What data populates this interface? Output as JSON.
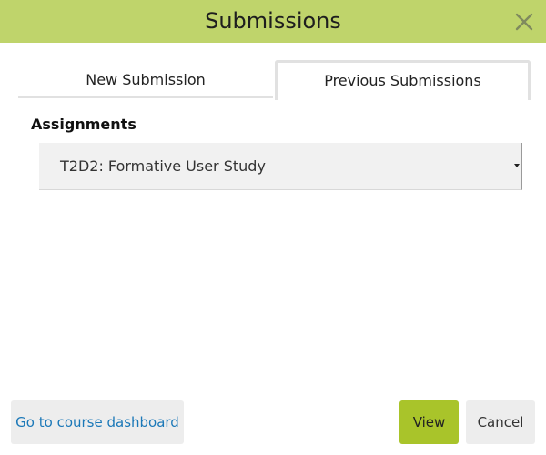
{
  "dialog": {
    "title": "Submissions",
    "close_icon": "close-icon"
  },
  "tabs": [
    {
      "label": "New Submission",
      "active": false
    },
    {
      "label": "Previous Submissions",
      "active": true
    }
  ],
  "assignments": {
    "label": "Assignments",
    "selected": "T2D2: Formative User Study",
    "arrow_icon": "caret-down-icon"
  },
  "footer": {
    "dashboard_label": "Go to course dashboard",
    "view_label": "View",
    "cancel_label": "Cancel"
  },
  "colors": {
    "header_bg": "#bfd46b",
    "primary_button": "#a9c42a",
    "link": "#1b78b8"
  }
}
